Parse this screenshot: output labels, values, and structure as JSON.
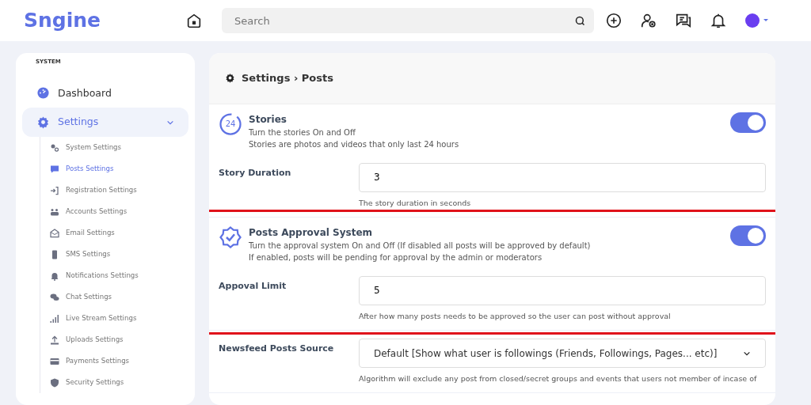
{
  "navbar": {
    "logo": "Sngine",
    "search": {
      "placeholder": "Search"
    }
  },
  "sidebar": {
    "heading": "SYSTEM",
    "items": [
      {
        "label": "Dashboard",
        "selected": false
      },
      {
        "label": "Settings",
        "selected": true,
        "expanded": true,
        "children": [
          {
            "label": "System Settings",
            "selected": false
          },
          {
            "label": "Posts Settings",
            "selected": true
          },
          {
            "label": "Registration Settings",
            "selected": false
          },
          {
            "label": "Accounts Settings",
            "selected": false
          },
          {
            "label": "Email Settings",
            "selected": false
          },
          {
            "label": "SMS Settings",
            "selected": false
          },
          {
            "label": "Notifications Settings",
            "selected": false
          },
          {
            "label": "Chat Settings",
            "selected": false
          },
          {
            "label": "Live Stream Settings",
            "selected": false
          },
          {
            "label": "Uploads Settings",
            "selected": false
          },
          {
            "label": "Payments Settings",
            "selected": false
          },
          {
            "label": "Security Settings",
            "selected": false
          }
        ]
      }
    ]
  },
  "panel": {
    "title": "Settings › Posts",
    "sections": [
      {
        "highlighted": false,
        "toggle": {
          "icon_text": "24",
          "title": "Stories",
          "lines": [
            "Turn the stories On and Off",
            "Stories are photos and videos that only last 24 hours"
          ],
          "on": true
        },
        "field": {
          "kind": "input",
          "label": "Story Duration",
          "value": "3",
          "help": "The story duration in seconds"
        }
      },
      {
        "highlighted": true,
        "toggle": {
          "title": "Posts Approval System",
          "lines": [
            "Turn the approval system On and Off (If disabled all posts will be approved by default)",
            "If enabled, posts will be pending for approval by the admin or moderators"
          ],
          "on": true
        },
        "field": {
          "kind": "input",
          "label": "Appoval Limit",
          "value": "5",
          "help": "After how many posts needs to be approved so the user can post without approval"
        }
      },
      {
        "highlighted": false,
        "field": {
          "kind": "select",
          "label": "Newsfeed Posts Source",
          "value": "Default [Show what user is followings (Friends, Followings, Pages... etc)]",
          "help": "Algorithm will exclude any post from closed/secret groups and events that users not member of incase of"
        }
      }
    ]
  }
}
